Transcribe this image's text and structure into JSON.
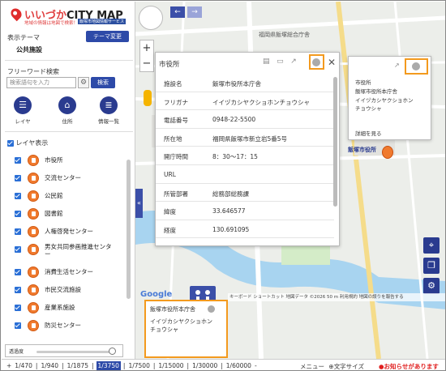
{
  "app": {
    "logo_title_red": "いいづか",
    "logo_title": "CITY MAP",
    "logo_sub": "地域の情報は地図で検索！",
    "logo_tag": "飯塚市地図情報サービス"
  },
  "sidebar": {
    "theme_label": "表示テーマ",
    "theme_button": "テーマ変更",
    "theme_value": "公共施設",
    "freeword_label": "フリーワード検索",
    "search_placeholder": "検索語句を入力",
    "search_button": "検索",
    "nav": [
      {
        "label": "レイヤ",
        "icon": "list-icon"
      },
      {
        "label": "住所",
        "icon": "home-icon"
      },
      {
        "label": "情報一覧",
        "icon": "info-list-icon"
      }
    ],
    "layer_header": "レイヤ表示",
    "layers": [
      "市役所",
      "交流センター",
      "公民館",
      "図書館",
      "人権啓発センター",
      "男女共同参画推進センター",
      "消費生活センター",
      "市民交流施設",
      "産業系施設",
      "防災センター"
    ],
    "opacity_label": "透過度",
    "opacity_value": 0.95
  },
  "map": {
    "label_building": "福岡県飯塚総合庁舎",
    "label_cityhall": "飯塚市役所",
    "attribution": "キーボード ショートカット   地図データ ©2026   50 m   利用規約   地図の誤りを報告する"
  },
  "popup": {
    "title": "市役所",
    "fields": [
      {
        "k": "施設名",
        "v": "飯塚市役所本庁舎"
      },
      {
        "k": "フリガナ",
        "v": "イイヅカシヤクショホンチョウシャ"
      },
      {
        "k": "電話番号",
        "v": "0948-22-5500"
      },
      {
        "k": "所在地",
        "v": "福岡県飯塚市新立岩5番5号"
      },
      {
        "k": "開庁時間",
        "v": "8：30～17：15"
      },
      {
        "k": "URL",
        "v": ""
      },
      {
        "k": "所管部署",
        "v": "総務部総務課"
      },
      {
        "k": "緯度",
        "v": "33.646577"
      },
      {
        "k": "経度",
        "v": "130.691095"
      }
    ]
  },
  "info_popup": {
    "l1": "市役所",
    "l2": "飯塚市役所本庁舎",
    "l3": "イイヅカシヤクショホン",
    "l4": "チョウシャ",
    "detail": "詳細を見る"
  },
  "bottom_popup": {
    "title": "飯塚市役所本庁舎",
    "r1": "イイヅカシヤクショホン",
    "r2": "チョウシャ"
  },
  "footer": {
    "scales": [
      "1/470",
      "1/940",
      "1/1875",
      "1/3750",
      "1/7500",
      "1/15000",
      "1/30000",
      "1/60000"
    ],
    "active_scale": "1/3750",
    "prefix": "+",
    "suffix": "-",
    "menu": "メニュー",
    "font_size": "文字サイズ",
    "notice": "お知らせがあります"
  }
}
